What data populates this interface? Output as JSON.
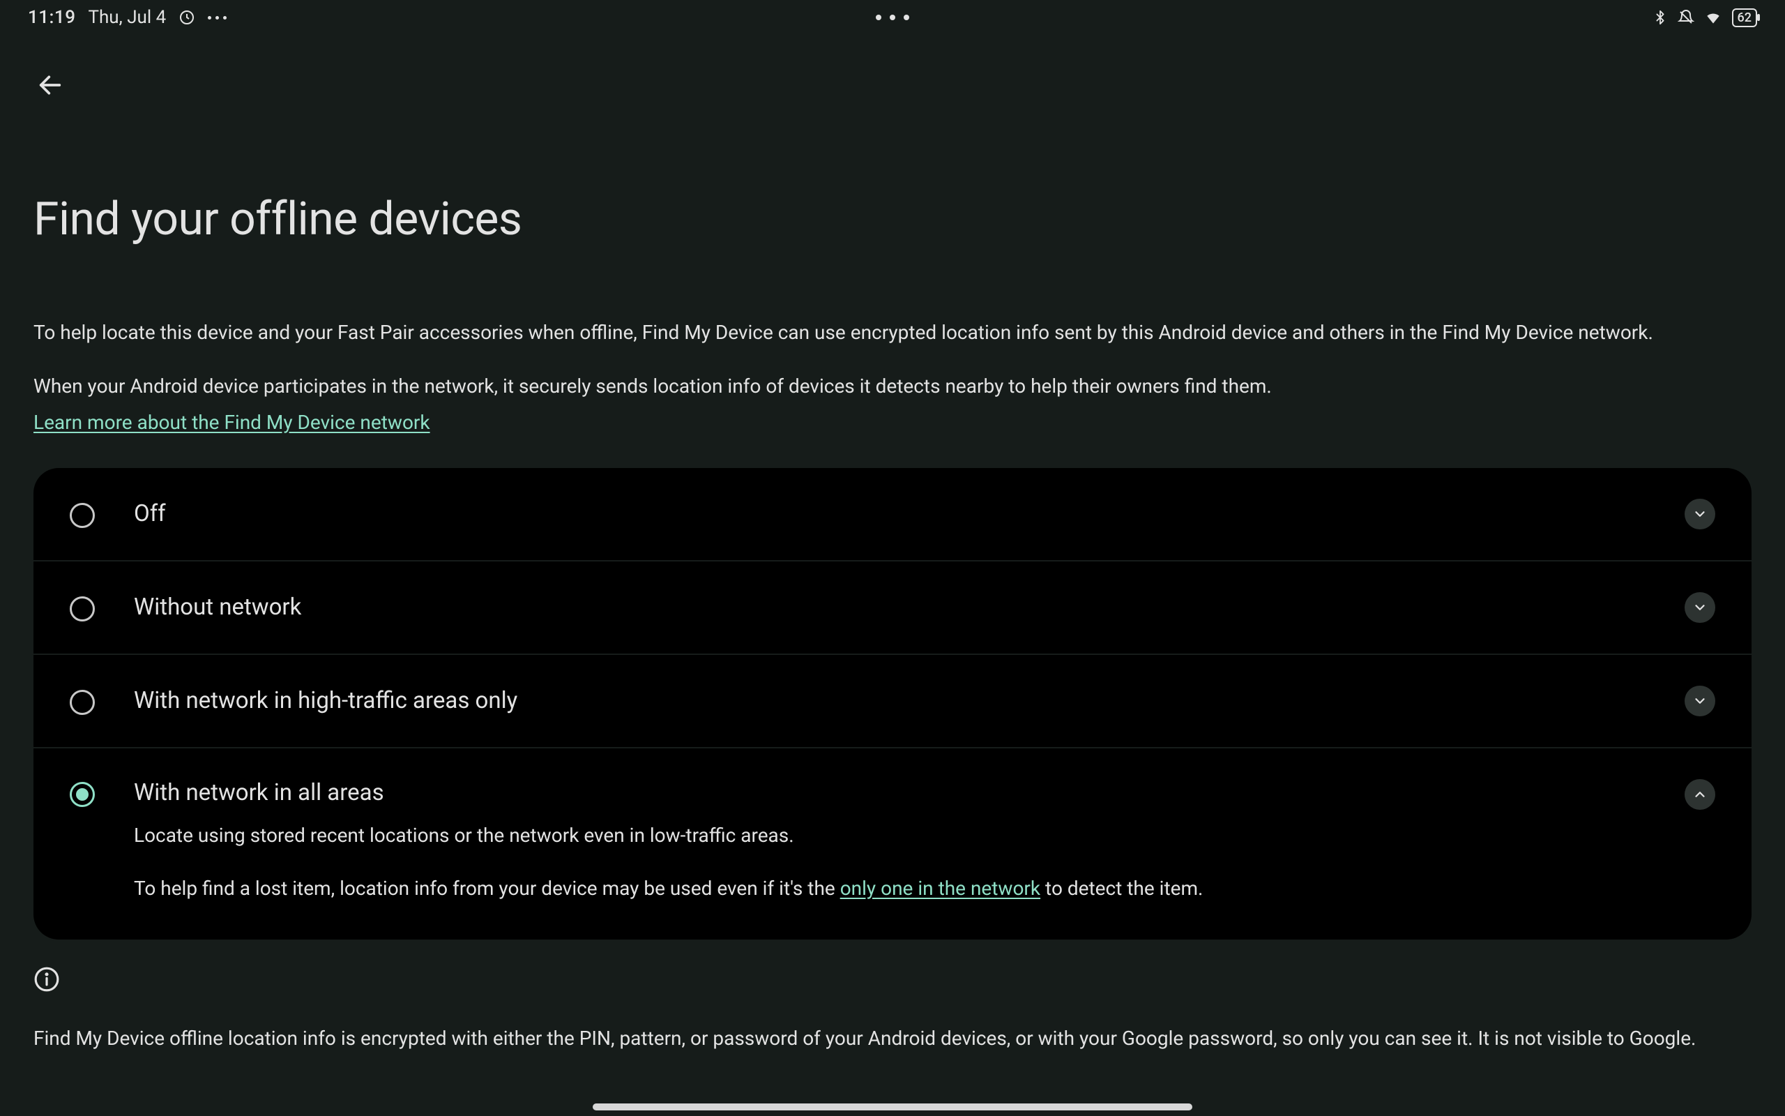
{
  "status": {
    "time": "11:19",
    "date": "Thu, Jul 4",
    "battery_level": "62"
  },
  "page": {
    "title": "Find your offline devices",
    "paragraph1": "To help locate this device and your Fast Pair accessories when offline, Find My Device can use encrypted location info sent by this Android device and others in the Find My Device network.",
    "paragraph2": "When your Android device participates in the network, it securely sends location info of devices it detects nearby to help their owners find them.",
    "learn_more": "Learn more about the Find My Device network"
  },
  "options": [
    {
      "id": "off",
      "label": "Off",
      "checked": false,
      "expanded": false
    },
    {
      "id": "without-network",
      "label": "Without network",
      "checked": false,
      "expanded": false
    },
    {
      "id": "high-traffic",
      "label": "With network in high-traffic areas only",
      "checked": false,
      "expanded": false
    },
    {
      "id": "all-areas",
      "label": "With network in all areas",
      "checked": true,
      "expanded": true,
      "sub_line1": "Locate using stored recent locations or the network even in low-traffic areas.",
      "sub_line2_prefix": "To help find a lost item, location info from your device may be used even if it's the ",
      "sub_line2_link": "only one in the network",
      "sub_line2_suffix": " to detect the item."
    }
  ],
  "footer": {
    "info_text": "Find My Device offline location info is encrypted with either the PIN, pattern, or password of your Android devices, or with your Google password, so only you can see it. It is not visible to Google."
  }
}
